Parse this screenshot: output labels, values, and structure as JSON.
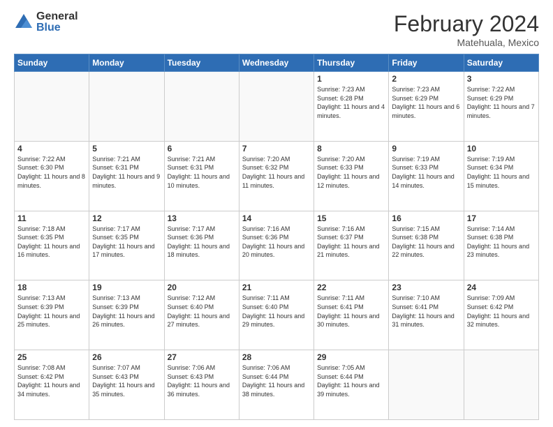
{
  "logo": {
    "general": "General",
    "blue": "Blue"
  },
  "header": {
    "month": "February 2024",
    "location": "Matehuala, Mexico"
  },
  "days_of_week": [
    "Sunday",
    "Monday",
    "Tuesday",
    "Wednesday",
    "Thursday",
    "Friday",
    "Saturday"
  ],
  "weeks": [
    [
      {
        "day": "",
        "info": ""
      },
      {
        "day": "",
        "info": ""
      },
      {
        "day": "",
        "info": ""
      },
      {
        "day": "",
        "info": ""
      },
      {
        "day": "1",
        "info": "Sunrise: 7:23 AM\nSunset: 6:28 PM\nDaylight: 11 hours\nand 4 minutes."
      },
      {
        "day": "2",
        "info": "Sunrise: 7:23 AM\nSunset: 6:29 PM\nDaylight: 11 hours\nand 6 minutes."
      },
      {
        "day": "3",
        "info": "Sunrise: 7:22 AM\nSunset: 6:29 PM\nDaylight: 11 hours\nand 7 minutes."
      }
    ],
    [
      {
        "day": "4",
        "info": "Sunrise: 7:22 AM\nSunset: 6:30 PM\nDaylight: 11 hours\nand 8 minutes."
      },
      {
        "day": "5",
        "info": "Sunrise: 7:21 AM\nSunset: 6:31 PM\nDaylight: 11 hours\nand 9 minutes."
      },
      {
        "day": "6",
        "info": "Sunrise: 7:21 AM\nSunset: 6:31 PM\nDaylight: 11 hours\nand 10 minutes."
      },
      {
        "day": "7",
        "info": "Sunrise: 7:20 AM\nSunset: 6:32 PM\nDaylight: 11 hours\nand 11 minutes."
      },
      {
        "day": "8",
        "info": "Sunrise: 7:20 AM\nSunset: 6:33 PM\nDaylight: 11 hours\nand 12 minutes."
      },
      {
        "day": "9",
        "info": "Sunrise: 7:19 AM\nSunset: 6:33 PM\nDaylight: 11 hours\nand 14 minutes."
      },
      {
        "day": "10",
        "info": "Sunrise: 7:19 AM\nSunset: 6:34 PM\nDaylight: 11 hours\nand 15 minutes."
      }
    ],
    [
      {
        "day": "11",
        "info": "Sunrise: 7:18 AM\nSunset: 6:35 PM\nDaylight: 11 hours\nand 16 minutes."
      },
      {
        "day": "12",
        "info": "Sunrise: 7:17 AM\nSunset: 6:35 PM\nDaylight: 11 hours\nand 17 minutes."
      },
      {
        "day": "13",
        "info": "Sunrise: 7:17 AM\nSunset: 6:36 PM\nDaylight: 11 hours\nand 18 minutes."
      },
      {
        "day": "14",
        "info": "Sunrise: 7:16 AM\nSunset: 6:36 PM\nDaylight: 11 hours\nand 20 minutes."
      },
      {
        "day": "15",
        "info": "Sunrise: 7:16 AM\nSunset: 6:37 PM\nDaylight: 11 hours\nand 21 minutes."
      },
      {
        "day": "16",
        "info": "Sunrise: 7:15 AM\nSunset: 6:38 PM\nDaylight: 11 hours\nand 22 minutes."
      },
      {
        "day": "17",
        "info": "Sunrise: 7:14 AM\nSunset: 6:38 PM\nDaylight: 11 hours\nand 23 minutes."
      }
    ],
    [
      {
        "day": "18",
        "info": "Sunrise: 7:13 AM\nSunset: 6:39 PM\nDaylight: 11 hours\nand 25 minutes."
      },
      {
        "day": "19",
        "info": "Sunrise: 7:13 AM\nSunset: 6:39 PM\nDaylight: 11 hours\nand 26 minutes."
      },
      {
        "day": "20",
        "info": "Sunrise: 7:12 AM\nSunset: 6:40 PM\nDaylight: 11 hours\nand 27 minutes."
      },
      {
        "day": "21",
        "info": "Sunrise: 7:11 AM\nSunset: 6:40 PM\nDaylight: 11 hours\nand 29 minutes."
      },
      {
        "day": "22",
        "info": "Sunrise: 7:11 AM\nSunset: 6:41 PM\nDaylight: 11 hours\nand 30 minutes."
      },
      {
        "day": "23",
        "info": "Sunrise: 7:10 AM\nSunset: 6:41 PM\nDaylight: 11 hours\nand 31 minutes."
      },
      {
        "day": "24",
        "info": "Sunrise: 7:09 AM\nSunset: 6:42 PM\nDaylight: 11 hours\nand 32 minutes."
      }
    ],
    [
      {
        "day": "25",
        "info": "Sunrise: 7:08 AM\nSunset: 6:42 PM\nDaylight: 11 hours\nand 34 minutes."
      },
      {
        "day": "26",
        "info": "Sunrise: 7:07 AM\nSunset: 6:43 PM\nDaylight: 11 hours\nand 35 minutes."
      },
      {
        "day": "27",
        "info": "Sunrise: 7:06 AM\nSunset: 6:43 PM\nDaylight: 11 hours\nand 36 minutes."
      },
      {
        "day": "28",
        "info": "Sunrise: 7:06 AM\nSunset: 6:44 PM\nDaylight: 11 hours\nand 38 minutes."
      },
      {
        "day": "29",
        "info": "Sunrise: 7:05 AM\nSunset: 6:44 PM\nDaylight: 11 hours\nand 39 minutes."
      },
      {
        "day": "",
        "info": ""
      },
      {
        "day": "",
        "info": ""
      }
    ]
  ]
}
